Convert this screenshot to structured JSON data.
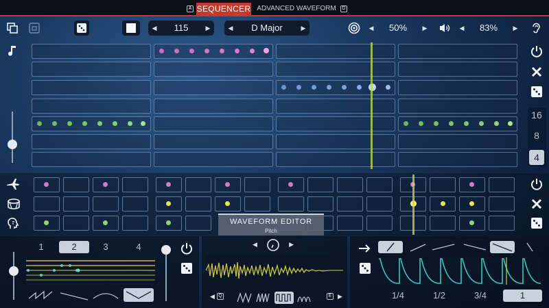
{
  "tabs": {
    "left_key": "A",
    "active": "SEQUENCER",
    "other": "ADVANCED WAVEFORM",
    "right_key": "D"
  },
  "toolbar": {
    "bpm": "115",
    "scale": "D Major",
    "swing": "50%",
    "volume": "83%"
  },
  "grid_counts": [
    "16",
    "8",
    "4"
  ],
  "waveform_editor": {
    "title": "WAVEFORM EDITOR",
    "subtitle": "Pitch"
  },
  "pattern_tabs": [
    "1",
    "2",
    "3",
    "4"
  ],
  "pattern_selected": "2",
  "wave_keys": {
    "left": "Q",
    "right": "E"
  },
  "length_options": [
    "1/4",
    "1/2",
    "3/4",
    "1"
  ],
  "length_selected": "1",
  "colors": {
    "accent_red": "#c23a2a",
    "pink": "#d878c8",
    "blue": "#7da4de",
    "green": "#8fd66e",
    "yellow": "#e5e84a",
    "playhead": "#c6d24a"
  },
  "icons": [
    "copy-icon",
    "paste-icon",
    "dice-icon",
    "stop-icon",
    "target-icon",
    "speaker-icon",
    "ear-icon",
    "note-icon",
    "power-icon",
    "close-icon",
    "plane-icon",
    "drum-icon",
    "head-icon"
  ]
}
